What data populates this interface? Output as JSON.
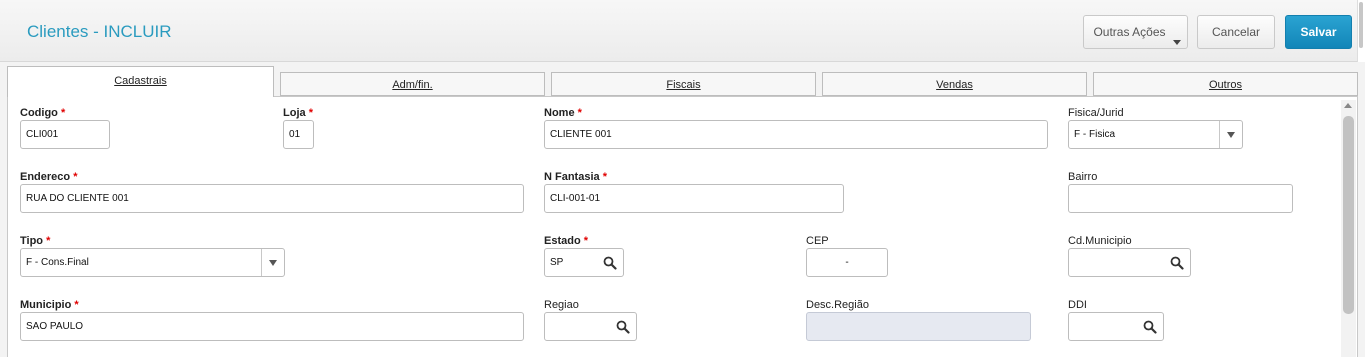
{
  "header": {
    "title": "Clientes - INCLUIR",
    "actions": {
      "outras_acoes": "Outras Ações",
      "cancelar": "Cancelar",
      "salvar": "Salvar"
    }
  },
  "tabs": [
    {
      "label": "Cadastrais",
      "active": true
    },
    {
      "label": "Adm/fin.",
      "active": false
    },
    {
      "label": "Fiscais",
      "active": false
    },
    {
      "label": "Vendas",
      "active": false
    },
    {
      "label": "Outros",
      "active": false
    }
  ],
  "form": {
    "codigo": {
      "label": "Codigo",
      "required": "*",
      "value": "CLI001"
    },
    "loja": {
      "label": "Loja",
      "required": "*",
      "value": "01"
    },
    "nome": {
      "label": "Nome",
      "required": "*",
      "value": "CLIENTE 001"
    },
    "fisica_jurid": {
      "label": "Fisica/Jurid",
      "value": "F - Fisica"
    },
    "endereco": {
      "label": "Endereco",
      "required": "*",
      "value": "RUA DO CLIENTE 001"
    },
    "n_fantasia": {
      "label": "N Fantasia",
      "required": "*",
      "value": "CLI-001-01"
    },
    "bairro": {
      "label": "Bairro",
      "value": ""
    },
    "tipo": {
      "label": "Tipo",
      "required": "*",
      "value": "F - Cons.Final"
    },
    "estado": {
      "label": "Estado",
      "required": "*",
      "value": "SP"
    },
    "cep": {
      "label": "CEP",
      "value": "-"
    },
    "cd_municipio": {
      "label": "Cd.Municipio",
      "value": ""
    },
    "municipio": {
      "label": "Municipio",
      "required": "*",
      "value": "SAO PAULO"
    },
    "regiao": {
      "label": "Regiao",
      "value": ""
    },
    "desc_regiao": {
      "label": "Desc.Região",
      "value": ""
    },
    "ddi": {
      "label": "DDI",
      "value": ""
    }
  },
  "colors": {
    "title": "#2a9bbf",
    "primary_button": "#1a8fc2",
    "required_mark": "#e00000",
    "disabled_field": "#e6e9f1"
  },
  "icons": {
    "search": "magnifier-icon",
    "dropdown": "chevron-down-icon"
  }
}
